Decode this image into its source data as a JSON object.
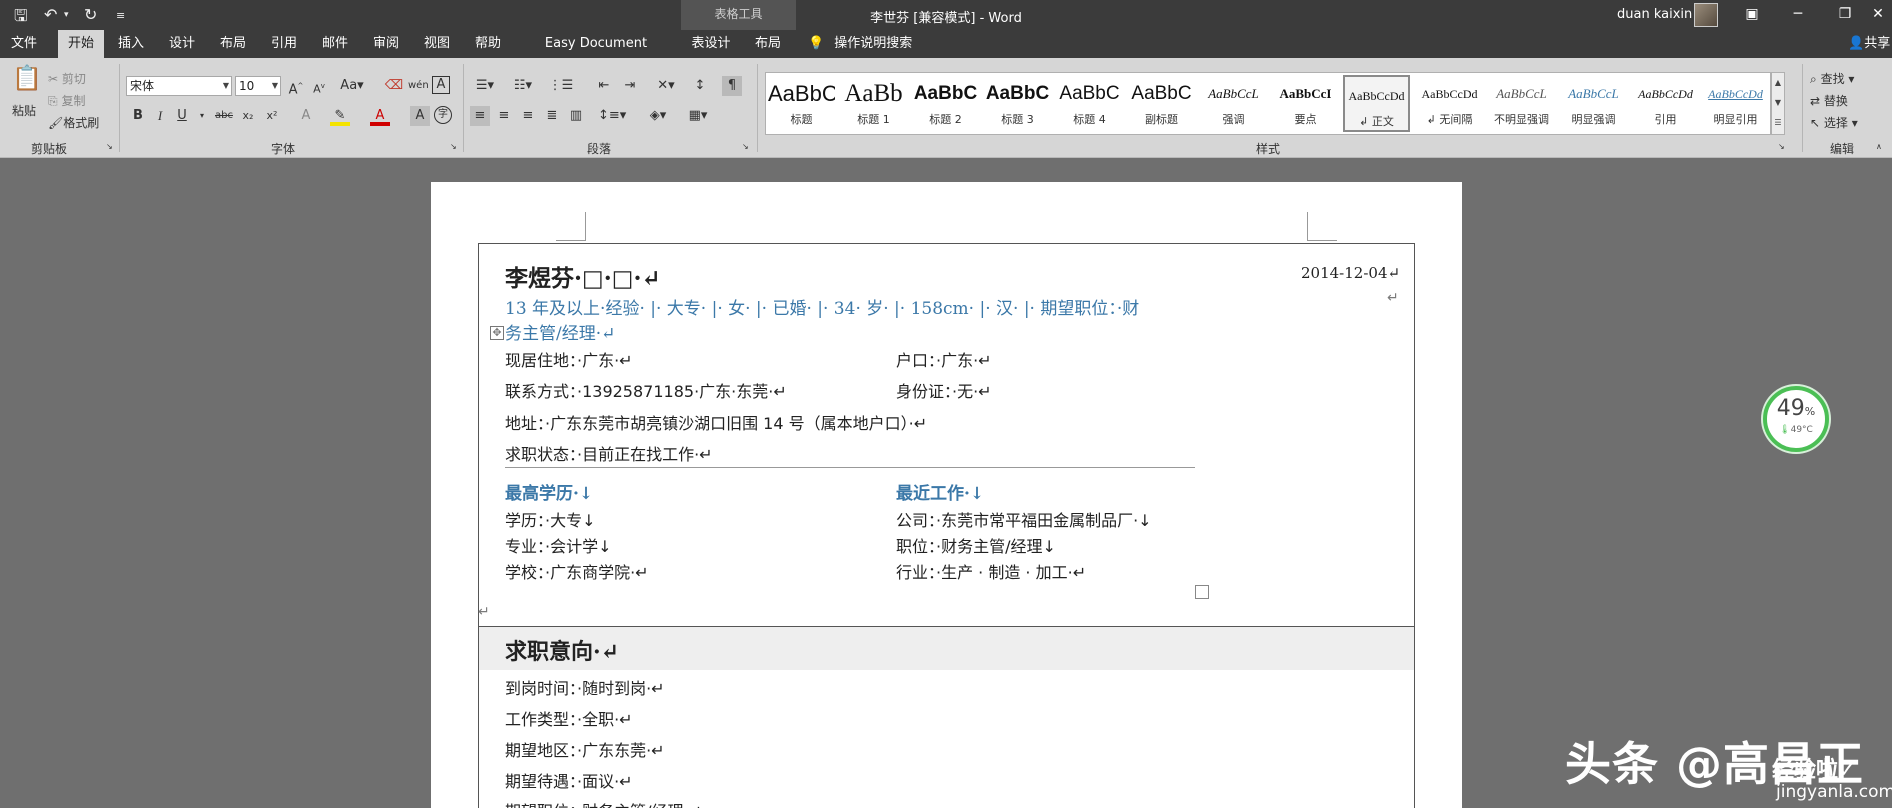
{
  "titlebar": {
    "context_tab": "表格工具",
    "doc_title": "李世芬 [兼容模式]  -  Word",
    "user": "duan kaixin"
  },
  "tabs": [
    "文件",
    "开始",
    "插入",
    "设计",
    "布局",
    "引用",
    "邮件",
    "审阅",
    "视图",
    "帮助",
    "Easy Document Creator",
    "表设计",
    "布局"
  ],
  "active_tab": "开始",
  "tell_me": "操作说明搜索",
  "share": "共享",
  "ribbon": {
    "clipboard": {
      "paste": "粘贴",
      "cut": "剪切",
      "copy": "复制",
      "format_painter": "格式刷",
      "label": "剪贴板"
    },
    "font": {
      "name": "宋体",
      "size": "10",
      "label": "字体",
      "bold": "B",
      "italic": "I",
      "underline": "U",
      "strike": "abc",
      "sub": "x₂",
      "sup": "x²"
    },
    "paragraph": {
      "label": "段落"
    },
    "styles": {
      "label": "样式",
      "items": [
        {
          "preview": "AaBbC",
          "name": "标题"
        },
        {
          "preview": "AaBb",
          "name": "标题 1"
        },
        {
          "preview": "AaBbC",
          "name": "标题 2"
        },
        {
          "preview": "AaBbC",
          "name": "标题 3"
        },
        {
          "preview": "AaBbC",
          "name": "标题 4"
        },
        {
          "preview": "AaBbC",
          "name": "副标题"
        },
        {
          "preview": "AaBbCcL",
          "name": "强调"
        },
        {
          "preview": "AaBbCcI",
          "name": "要点"
        },
        {
          "preview": "AaBbCcDd",
          "name": "↲ 正文"
        },
        {
          "preview": "AaBbCcDd",
          "name": "↲ 无间隔"
        },
        {
          "preview": "AaBbCcL",
          "name": "不明显强调"
        },
        {
          "preview": "AaBbCcL",
          "name": "明显强调"
        },
        {
          "preview": "AaBbCcDd",
          "name": "引用"
        },
        {
          "preview": "AaBbCcDd",
          "name": "明显引用"
        }
      ]
    },
    "editing": {
      "find": "查找",
      "replace": "替换",
      "select": "选择",
      "label": "编辑"
    }
  },
  "resume": {
    "name": "李煜芬·□·□·↵",
    "date": "2014-12-04↵",
    "summary_1": "13 年及以上·经验· |· 大专· |· 女· |· 已婚· |· 34· 岁· |· 158cm· |· 汉· |· 期望职位：·财",
    "summary_2": "务主管/经理·↵",
    "residence": "现居住地：·广东·↵",
    "hukou": "户口：·广东·↵",
    "contact": "联系方式：·13925871185·广东·东莞·↵",
    "idcard": "身份证：·无·↵",
    "address": "地址：·广东东莞市胡亮镇沙湖口旧围 14 号（属本地户口）·↵",
    "status": "求职状态：·目前正在找工作·↵",
    "edu_title": "最高学历·↓",
    "work_title": "最近工作·↓",
    "degree": "学历：·大专↓",
    "company": "公司：·东莞市常平福田金属制品厂·↓",
    "major": "专业：·会计学↓",
    "position": "职位：·财务主管/经理↓",
    "school": "学校：·广东商学院·↵",
    "industry": "行业：·生产 · 制造 · 加工·↵",
    "section_title": "求职意向·↵",
    "arrival": "到岗时间：·随时到岗·↵",
    "work_type": "工作类型：·全职·↵",
    "region": "期望地区：·广东东莞·↵",
    "salary": "期望待遇：·面议·↵",
    "exp_position": "期望职位：·财务主管/经理·↵"
  },
  "gauge": {
    "percent": "49",
    "unit": "%",
    "temp": "49°C"
  },
  "watermark": {
    "main": "头条 @高昌正",
    "logo": "经验啦✓",
    "url": "jingyanla.com"
  }
}
